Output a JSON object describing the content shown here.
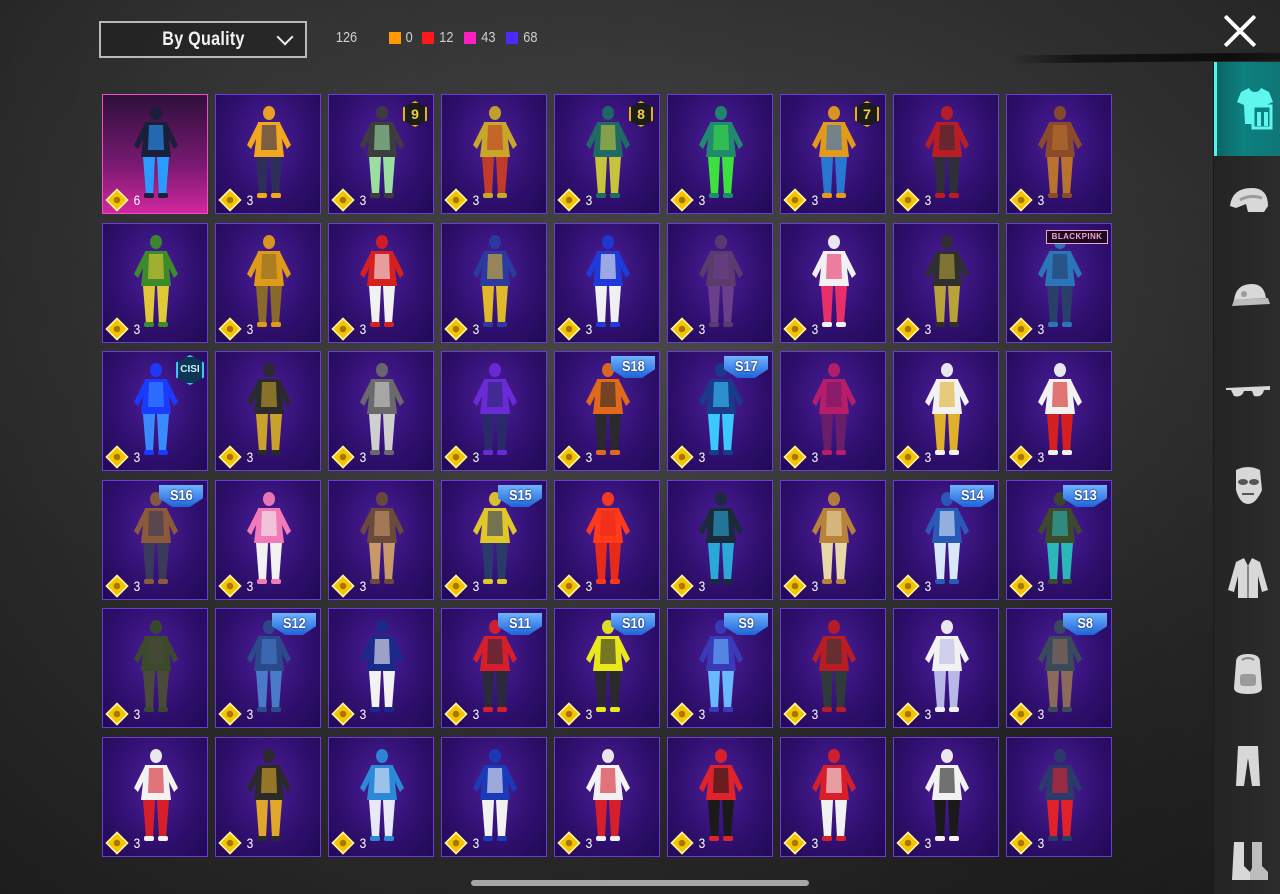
{
  "header": {
    "sort_label": "By Quality",
    "total_count": "126",
    "quality_counts": [
      {
        "color": "#ff9a00",
        "count": "0"
      },
      {
        "color": "#ff1a1a",
        "count": "12"
      },
      {
        "color": "#ff1fbf",
        "count": "43"
      },
      {
        "color": "#4a2cff",
        "count": "68"
      }
    ]
  },
  "colors": {
    "card_epic_bg": "#301070",
    "card_legendary_bg": "#d2279f",
    "sidebar_active": "#0d8080",
    "coin": "#f5c400"
  },
  "items": [
    {
      "price": "6",
      "quality": "legendary",
      "badge": null,
      "c1": "#1a1f3a",
      "c2": "#2b9bff"
    },
    {
      "price": "3",
      "badge": null,
      "c1": "#f2a81e",
      "c2": "#2d2f5a"
    },
    {
      "price": "3",
      "badge": {
        "type": "level",
        "text": "9"
      },
      "c1": "#3d3d3d",
      "c2": "#9adfa0"
    },
    {
      "price": "3",
      "badge": null,
      "c1": "#c7a62a",
      "c2": "#c13b2b"
    },
    {
      "price": "3",
      "badge": {
        "type": "level",
        "text": "8"
      },
      "c1": "#1f6a63",
      "c2": "#c6c43e"
    },
    {
      "price": "3",
      "badge": null,
      "c1": "#1f8a6e",
      "c2": "#3de03e"
    },
    {
      "price": "3",
      "badge": {
        "type": "level",
        "text": "7"
      },
      "c1": "#e29a1a",
      "c2": "#2a77d2"
    },
    {
      "price": "3",
      "badge": null,
      "c1": "#b81d24",
      "c2": "#2f2f3a"
    },
    {
      "price": "3",
      "badge": null,
      "c1": "#8b4a2a",
      "c2": "#b8732f"
    },
    {
      "price": "3",
      "badge": null,
      "c1": "#3d8a2a",
      "c2": "#e0c838"
    },
    {
      "price": "3",
      "badge": null,
      "c1": "#e09a1a",
      "c2": "#8a6a2a"
    },
    {
      "price": "3",
      "badge": null,
      "c1": "#d61f1f",
      "c2": "#f1f1f1"
    },
    {
      "price": "3",
      "badge": null,
      "c1": "#2b3aa0",
      "c2": "#e0b82a"
    },
    {
      "price": "3",
      "badge": null,
      "c1": "#1e3ad8",
      "c2": "#f0f0f0"
    },
    {
      "price": "3",
      "badge": null,
      "c1": "#5b3a6e",
      "c2": "#6a3f8a"
    },
    {
      "price": "3",
      "badge": null,
      "c1": "#f2f2f2",
      "c2": "#e82f6a"
    },
    {
      "price": "3",
      "badge": null,
      "c1": "#2f2f2f",
      "c2": "#b8a33a"
    },
    {
      "price": "3",
      "badge": {
        "type": "brand",
        "text": "BLACKPINK"
      },
      "c1": "#2a76b8",
      "c2": "#2a3e6a"
    },
    {
      "price": "3",
      "badge": {
        "type": "event",
        "text": "CISI"
      },
      "c1": "#1a3aff",
      "c2": "#3a8aff"
    },
    {
      "price": "3",
      "badge": null,
      "c1": "#2a2a2a",
      "c2": "#c8a22a"
    },
    {
      "price": "3",
      "badge": null,
      "c1": "#6a6a6a",
      "c2": "#cfcfcf"
    },
    {
      "price": "3",
      "badge": null,
      "c1": "#6a2ad8",
      "c2": "#2a2a6a"
    },
    {
      "price": "3",
      "badge": {
        "type": "season",
        "text": "S18"
      },
      "c1": "#e06a1a",
      "c2": "#2a2a2a"
    },
    {
      "price": "3",
      "badge": {
        "type": "season",
        "text": "S17"
      },
      "c1": "#1a3a8a",
      "c2": "#3ac8ff"
    },
    {
      "price": "3",
      "badge": null,
      "c1": "#b81d6a",
      "c2": "#6a1d6a"
    },
    {
      "price": "3",
      "badge": null,
      "c1": "#f2f2f2",
      "c2": "#e0b02a"
    },
    {
      "price": "3",
      "badge": null,
      "c1": "#f2f2f2",
      "c2": "#d61f1f"
    },
    {
      "price": "3",
      "badge": {
        "type": "season",
        "text": "S16"
      },
      "c1": "#8a5a3a",
      "c2": "#3a3a5a"
    },
    {
      "price": "3",
      "badge": null,
      "c1": "#f27ab8",
      "c2": "#f2f2f2"
    },
    {
      "price": "3",
      "badge": null,
      "c1": "#6a4a3a",
      "c2": "#c89a6a"
    },
    {
      "price": "3",
      "badge": {
        "type": "season",
        "text": "S15"
      },
      "c1": "#e0c82a",
      "c2": "#2a3a6a"
    },
    {
      "price": "3",
      "badge": null,
      "c1": "#ff3a1a",
      "c2": "#e82a1a"
    },
    {
      "price": "3",
      "badge": null,
      "c1": "#1a2a3a",
      "c2": "#2aa8d8"
    },
    {
      "price": "3",
      "badge": null,
      "c1": "#b8823a",
      "c2": "#e8d8a8"
    },
    {
      "price": "3",
      "badge": {
        "type": "season",
        "text": "S14"
      },
      "c1": "#2a5ab8",
      "c2": "#d8e8f8"
    },
    {
      "price": "3",
      "badge": {
        "type": "season",
        "text": "S13"
      },
      "c1": "#3a4a2a",
      "c2": "#2ab8b8"
    },
    {
      "price": "3",
      "badge": null,
      "c1": "#3a4a2a",
      "c2": "#4a4a3a"
    },
    {
      "price": "3",
      "badge": {
        "type": "season",
        "text": "S12"
      },
      "c1": "#2a4a8a",
      "c2": "#4a7ac8"
    },
    {
      "price": "3",
      "badge": null,
      "c1": "#1a2a8a",
      "c2": "#f2f2f2"
    },
    {
      "price": "3",
      "badge": {
        "type": "season",
        "text": "S11"
      },
      "c1": "#d61f2a",
      "c2": "#2a2a3a"
    },
    {
      "price": "3",
      "badge": {
        "type": "season",
        "text": "S10"
      },
      "c1": "#e8e81a",
      "c2": "#2a2a2a"
    },
    {
      "price": "3",
      "badge": {
        "type": "season",
        "text": "S9"
      },
      "c1": "#3a3ab8",
      "c2": "#6ab8ff"
    },
    {
      "price": "3",
      "badge": null,
      "c1": "#b81d24",
      "c2": "#2f3a3a"
    },
    {
      "price": "3",
      "badge": null,
      "c1": "#f2f2f2",
      "c2": "#b8b8e8"
    },
    {
      "price": "3",
      "badge": {
        "type": "season",
        "text": "S8"
      },
      "c1": "#3a4a5a",
      "c2": "#8a6a5a"
    },
    {
      "price": "3",
      "badge": null,
      "c1": "#f2f2f2",
      "c2": "#d61f2a"
    },
    {
      "price": "3",
      "badge": null,
      "c1": "#2a2a2a",
      "c2": "#e0a82a"
    },
    {
      "price": "3",
      "badge": null,
      "c1": "#2a8ad8",
      "c2": "#e8e8f8"
    },
    {
      "price": "3",
      "badge": null,
      "c1": "#1a3ab8",
      "c2": "#f2f2f2"
    },
    {
      "price": "3",
      "badge": null,
      "c1": "#f2f2f2",
      "c2": "#d61f2a"
    },
    {
      "price": "3",
      "badge": null,
      "c1": "#e0222a",
      "c2": "#1a1a1a"
    },
    {
      "price": "3",
      "badge": null,
      "c1": "#d61f2a",
      "c2": "#f2f2f2"
    },
    {
      "price": "3",
      "badge": null,
      "c1": "#f2f2f2",
      "c2": "#1a1a1a"
    },
    {
      "price": "3",
      "badge": null,
      "c1": "#2a3a6a",
      "c2": "#e0222a"
    }
  ],
  "sidebar": [
    {
      "icon": "outfit-icon",
      "active": true
    },
    {
      "icon": "helmet-icon",
      "active": false
    },
    {
      "icon": "cap-icon",
      "active": false
    },
    {
      "icon": "glasses-icon",
      "active": false
    },
    {
      "icon": "mask-icon",
      "active": false
    },
    {
      "icon": "jacket-icon",
      "active": false
    },
    {
      "icon": "backpack-icon",
      "active": false
    },
    {
      "icon": "pants-icon",
      "active": false
    },
    {
      "icon": "shoes-icon",
      "active": false
    }
  ]
}
